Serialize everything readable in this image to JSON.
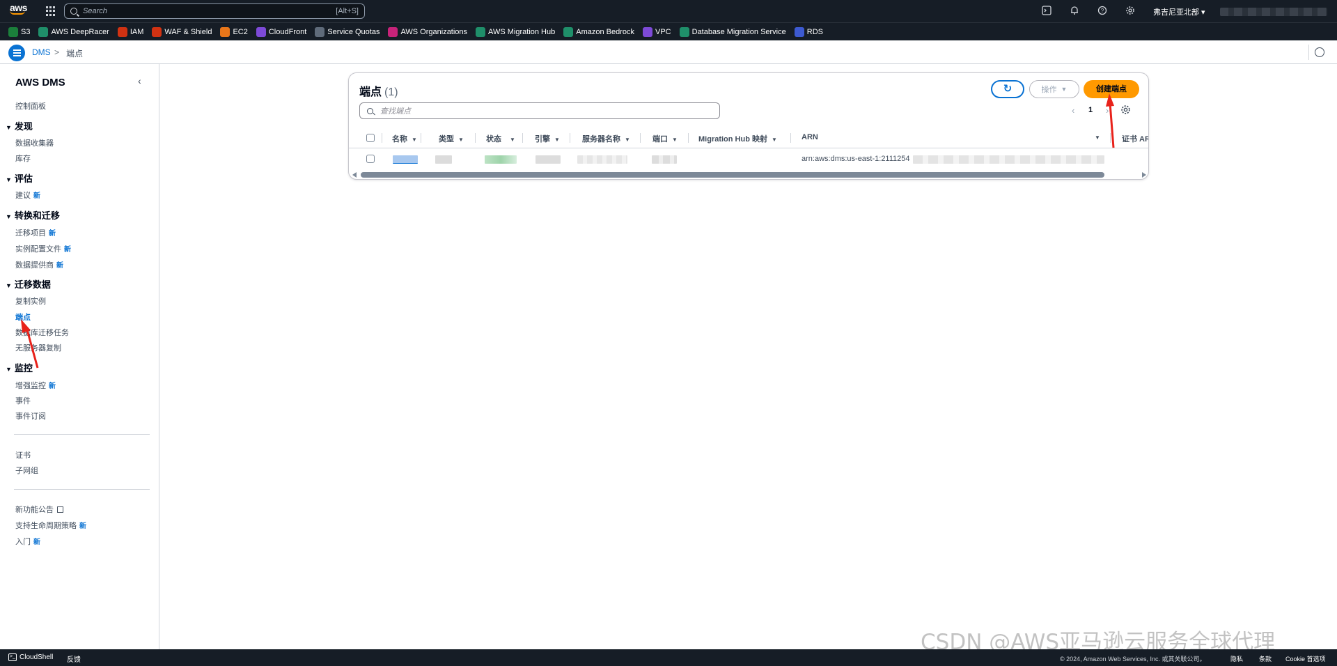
{
  "topnav": {
    "logo": "aws",
    "search_placeholder": "Search",
    "search_shortcut": "[Alt+S]",
    "region": "弗吉尼亚北部 ▾"
  },
  "favorites": [
    {
      "label": "S3",
      "color": "#1b7f3b"
    },
    {
      "label": "AWS DeepRacer",
      "color": "#1f8f6a"
    },
    {
      "label": "IAM",
      "color": "#d13212"
    },
    {
      "label": "WAF & Shield",
      "color": "#d13212"
    },
    {
      "label": "EC2",
      "color": "#e8761a"
    },
    {
      "label": "CloudFront",
      "color": "#7d4ad8"
    },
    {
      "label": "Service Quotas",
      "color": "#5f6b7a"
    },
    {
      "label": "AWS Organizations",
      "color": "#c7237a"
    },
    {
      "label": "AWS Migration Hub",
      "color": "#1f8f6a"
    },
    {
      "label": "Amazon Bedrock",
      "color": "#1f8f6a"
    },
    {
      "label": "VPC",
      "color": "#7d4ad8"
    },
    {
      "label": "Database Migration Service",
      "color": "#1f8f6a"
    },
    {
      "label": "RDS",
      "color": "#3d5ad1"
    }
  ],
  "breadcrumb": {
    "root": "DMS",
    "separator": ">",
    "current": "端点"
  },
  "sidebar": {
    "title": "AWS DMS",
    "new_badge": "新",
    "dashboard": "控制面板",
    "sections": [
      {
        "heading": "发现",
        "items": [
          {
            "label": "数据收集器"
          },
          {
            "label": "库存"
          }
        ]
      },
      {
        "heading": "评估",
        "items": [
          {
            "label": "建议",
            "new": true
          }
        ]
      },
      {
        "heading": "转换和迁移",
        "items": [
          {
            "label": "迁移项目",
            "new": true
          },
          {
            "label": "实例配置文件",
            "new": true
          },
          {
            "label": "数据提供商",
            "new": true
          }
        ]
      },
      {
        "heading": "迁移数据",
        "items": [
          {
            "label": "复制实例"
          },
          {
            "label": "端点",
            "active": true
          },
          {
            "label": "数据库迁移任务"
          },
          {
            "label": "无服务器复制"
          }
        ]
      },
      {
        "heading": "监控",
        "items": [
          {
            "label": "增强监控",
            "new": true
          },
          {
            "label": "事件"
          },
          {
            "label": "事件订阅"
          }
        ]
      }
    ],
    "extra1": [
      "证书",
      "子网组"
    ],
    "extra2": [
      {
        "label": "新功能公告",
        "external": true
      },
      {
        "label": "支持生命周期策略",
        "new": true
      },
      {
        "label": "入门",
        "new": true
      }
    ]
  },
  "panel": {
    "title": "端点",
    "count": "(1)",
    "actions_label": "操作",
    "create_label": "创建端点",
    "search_placeholder": "查找端点",
    "page": "1",
    "columns": [
      "名称",
      "类型",
      "状态",
      "引擎",
      "服务器名称",
      "端口",
      "Migration Hub 映射",
      "ARN",
      "证书 AR"
    ],
    "row": {
      "arn": "arn:aws:dms:us-east-1:2111254"
    }
  },
  "footer": {
    "cloudshell": "CloudShell",
    "feedback": "反馈",
    "copyright": "© 2024, Amazon Web Services, Inc. 或其关联公司。",
    "links": [
      "隐私",
      "条款",
      "Cookie 首选项"
    ]
  },
  "watermark": "CSDN @AWS亚马逊云服务全球代理"
}
